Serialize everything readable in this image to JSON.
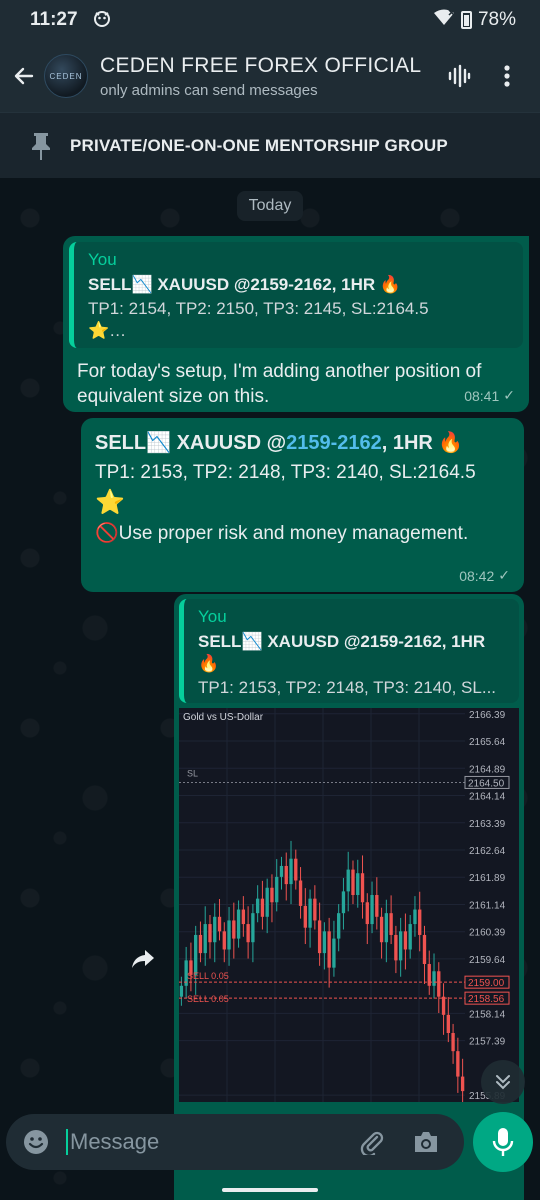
{
  "status_bar": {
    "time": "11:27",
    "battery": "78%"
  },
  "header": {
    "avatar_text": "CEDEN",
    "title": "CEDEN FREE FOREX OFFICIAL",
    "subtitle": "only admins can send messages"
  },
  "pinned": {
    "text": "PRIVATE/ONE-ON-ONE MENTORSHIP GROUP"
  },
  "chat": {
    "date_chip": "Today",
    "messages": [
      {
        "quote_author": "You",
        "quote_line1": "SELL📉 XAUUSD @2159-2162,  1HR 🔥",
        "quote_line2": "TP1: 2154, TP2: 2150, TP3: 2145, SL:2164.5",
        "quote_line3": "⭐…",
        "body": "For today's setup, I'm adding another position of equivalent size on this.",
        "time": "08:41",
        "tick": "✓"
      },
      {
        "line1_prefix": "SELL📉 XAUUSD @",
        "line1_range": "2159-2162",
        "line1_suffix": ",  1HR 🔥",
        "line2": "TP1: 2153, TP2: 2148, TP3: 2140, SL:2164.5",
        "line3": "⭐",
        "line4": "🚫Use proper risk and money management.",
        "time": "08:42",
        "tick": "✓"
      },
      {
        "quote_author": "You",
        "quote_line1": "SELL📉 XAUUSD @2159-2162,  1HR",
        "quote_line1b": "🔥",
        "quote_line2": "TP1: 2153, TP2: 2148, TP3: 2140, SL..."
      }
    ]
  },
  "chart_data": {
    "type": "candlestick",
    "title": "Gold vs US-Dollar",
    "y_ticks": [
      2166.39,
      2165.64,
      2164.89,
      2164.14,
      2163.39,
      2162.64,
      2161.89,
      2161.14,
      2160.39,
      2159.64,
      2158.14,
      2157.39,
      2155.89
    ],
    "ylim": [
      2155.7,
      2166.55
    ],
    "sl": {
      "label": "SL",
      "value": 2164.5,
      "tag": "2164.50"
    },
    "orders": [
      {
        "label": "SELL 0.05",
        "value": 2159.0,
        "tag": "2159.00"
      },
      {
        "label": "SELL 0.05",
        "value": 2158.56,
        "tag": "2158.56"
      }
    ],
    "candle_closes": [
      2158.9,
      2159.6,
      2159.2,
      2160.3,
      2159.8,
      2160.6,
      2160.1,
      2160.8,
      2160.4,
      2159.9,
      2160.7,
      2160.2,
      2161.0,
      2160.6,
      2160.1,
      2160.9,
      2161.3,
      2160.8,
      2161.6,
      2161.2,
      2161.9,
      2162.2,
      2161.7,
      2162.4,
      2161.8,
      2161.1,
      2160.5,
      2161.3,
      2160.7,
      2159.8,
      2160.4,
      2159.4,
      2160.2,
      2160.9,
      2161.5,
      2162.1,
      2161.4,
      2162.0,
      2161.2,
      2160.6,
      2161.4,
      2160.8,
      2160.1,
      2160.9,
      2160.3,
      2159.6,
      2160.4,
      2159.9,
      2160.6,
      2161.0,
      2160.3,
      2159.5,
      2158.9,
      2159.3,
      2158.6,
      2158.1,
      2157.6,
      2157.1,
      2156.4,
      2156.0
    ]
  },
  "input": {
    "placeholder": "Message"
  },
  "colors": {
    "accent": "#00a884",
    "bubble_out": "#005c4b",
    "quote_bar": "#06cf9c",
    "link": "#53bdeb",
    "bull_candle": "#26a69a",
    "bear_candle": "#ef5350"
  }
}
